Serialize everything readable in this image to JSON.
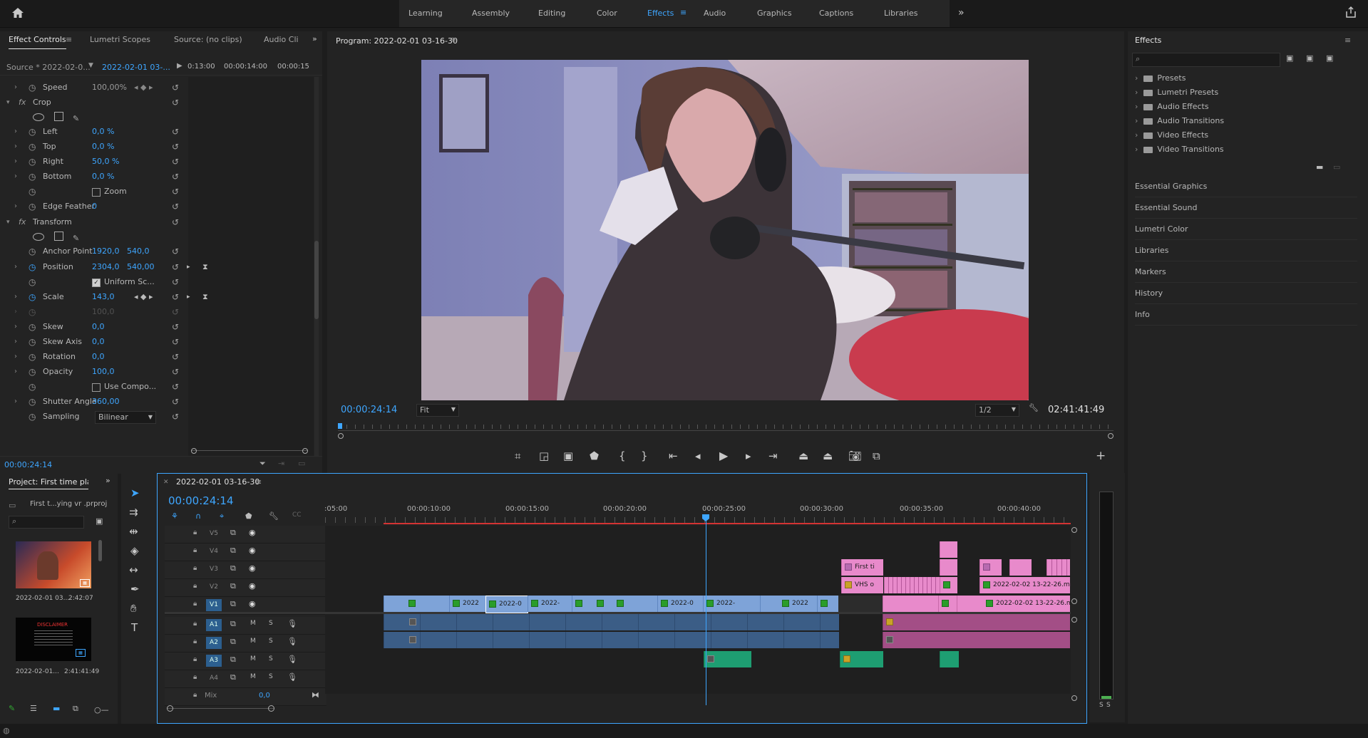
{
  "topbar": {
    "workspaces": [
      "Learning",
      "Assembly",
      "Editing",
      "Color",
      "Effects",
      "Audio",
      "Graphics",
      "Captions",
      "Libraries"
    ],
    "active_workspace": "Effects"
  },
  "left_tabs": [
    "Effect Controls",
    "Lumetri Scopes",
    "Source: (no clips)",
    "Audio Cli"
  ],
  "effect_controls": {
    "source_label": "Source * 2022-02-0...",
    "sequence_label": "2022-02-01 03-...",
    "ruler": [
      "0:13:00",
      "00:00:14:00",
      "00:00:15"
    ],
    "speed_label": "Speed",
    "speed_value": "100,00%",
    "crop_label": "Crop",
    "fx": "fx",
    "left_label": "Left",
    "left_value": "0,0 %",
    "top_label": "Top",
    "top_value": "0,0 %",
    "right_label": "Right",
    "right_value": "50,0 %",
    "bottom_label": "Bottom",
    "bottom_value": "0,0 %",
    "zoom_label": "Zoom",
    "edge_label": "Edge Feather",
    "edge_value": "0",
    "transform_label": "Transform",
    "anchor_label": "Anchor Point",
    "anchor_x": "1920,0",
    "anchor_y": "540,0",
    "position_label": "Position",
    "position_x": "2304,0",
    "position_y": "540,00",
    "uniform_label": "Uniform Sc...",
    "scale_label": "Scale",
    "scale_value": "143,0",
    "scale_w_value": "100,0",
    "skew_label": "Skew",
    "skew_value": "0,0",
    "skewaxis_label": "Skew Axis",
    "skewaxis_value": "0,0",
    "rotation_label": "Rotation",
    "rotation_value": "0,0",
    "opacity_label": "Opacity",
    "opacity_value": "100,0",
    "usecomp_label": "Use Compo...",
    "shutter_label": "Shutter Angle",
    "shutter_value": "360,00",
    "sampling_label": "Sampling",
    "sampling_value": "Bilinear",
    "timecode": "00:00:24:14"
  },
  "program": {
    "title": "Program: 2022-02-01 03-16-30",
    "timecode": "00:00:24:14",
    "fit": "Fit",
    "resolution": "1/2",
    "duration": "02:41:41:49"
  },
  "effects_panel": {
    "title": "Effects",
    "folders": [
      "Presets",
      "Lumetri Presets",
      "Audio Effects",
      "Audio Transitions",
      "Video Effects",
      "Video Transitions"
    ],
    "sections": [
      "Essential Graphics",
      "Essential Sound",
      "Lumetri Color",
      "Libraries",
      "Markers",
      "History",
      "Info"
    ]
  },
  "project": {
    "title": "Project: First time play",
    "file": "First t...ying vr .prproj",
    "items": [
      {
        "name": "2022-02-01 03...",
        "duration": "2:42:07"
      },
      {
        "name": "2022-02-01...",
        "duration": "2:41:41:49"
      }
    ],
    "disclaimer": "DISCLAIMER"
  },
  "timeline": {
    "title": "2022-02-01 03-16-30",
    "timecode": "00:00:24:14",
    "ruler_labels": [
      ":05:00",
      "00:00:10:00",
      "00:00:15:00",
      "00:00:20:00",
      "00:00:25:00",
      "00:00:30:00",
      "00:00:35:00",
      "00:00:40:00"
    ],
    "video_tracks": [
      "V5",
      "V4",
      "V3",
      "V2",
      "V1"
    ],
    "audio_tracks": [
      "A1",
      "A2",
      "A3",
      "A4"
    ],
    "mix_label": "Mix",
    "mix_value": "0,0",
    "m": "M",
    "s": "S",
    "clip_labels": {
      "v3_first": "First ti",
      "v2_vhs": "VHS o",
      "v2_long": "2022-02-02 13-22-26.m",
      "v1_long": "2022-02-02 13-22-26.m",
      "v1_short": [
        "2022",
        "2022-0",
        "2022-",
        "2022-0",
        "2022-",
        "2022"
      ]
    }
  },
  "meter": {
    "s1": "S",
    "s2": "S"
  }
}
